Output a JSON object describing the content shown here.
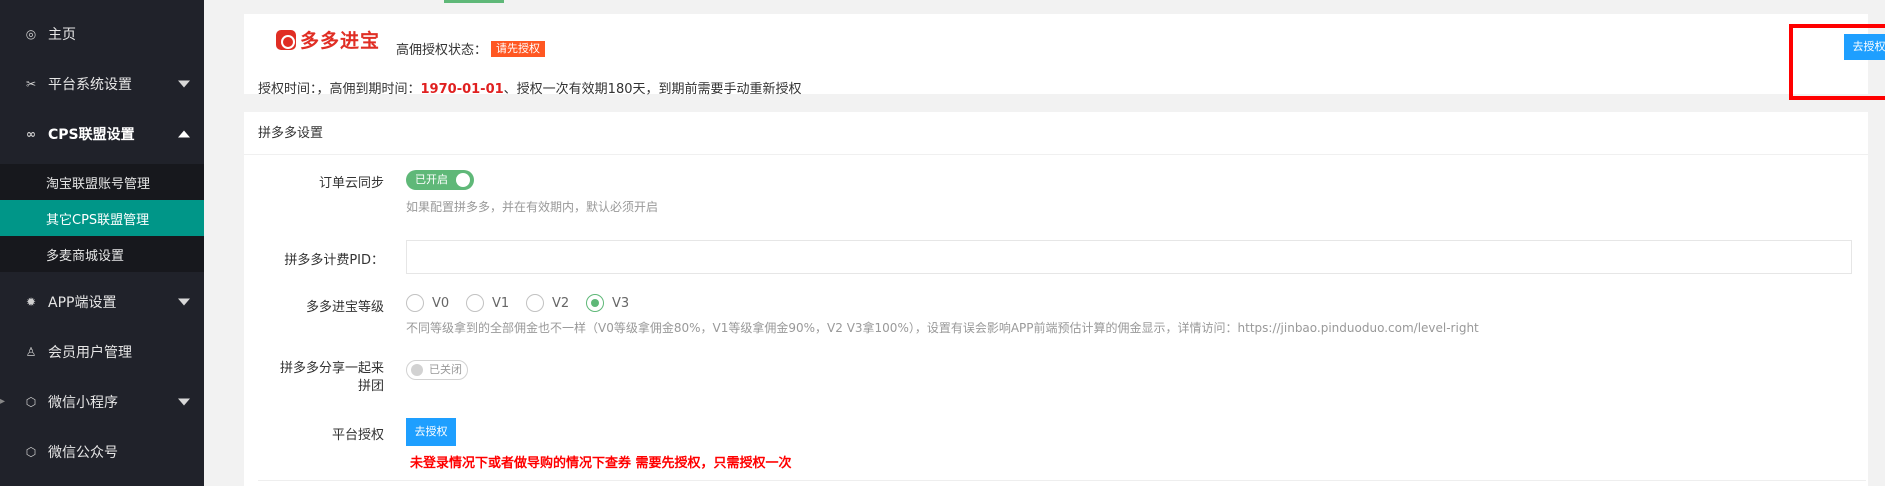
{
  "sidebar": {
    "items": [
      {
        "label": "主页",
        "icon": "shield-icon"
      },
      {
        "label": "平台系统设置",
        "icon": "tools-icon"
      },
      {
        "label": "CPS联盟设置",
        "icon": "infinity-icon"
      },
      {
        "label": "APP端设置",
        "icon": "gear-icon"
      },
      {
        "label": "会员用户管理",
        "icon": "user-icon"
      },
      {
        "label": "微信小程序",
        "icon": "cube-icon"
      },
      {
        "label": "微信公众号",
        "icon": "cube-icon"
      }
    ],
    "sub_items": [
      {
        "label": "淘宝联盟账号管理"
      },
      {
        "label": "其它CPS联盟管理"
      },
      {
        "label": "多麦商城设置"
      }
    ]
  },
  "auth_card": {
    "brand": "多多进宝",
    "status_label": "高佣授权状态：",
    "status_badge": "请先授权",
    "line_prefix": "授权时间：，高佣到期时间：",
    "expire_date": "1970-01-01",
    "line_suffix": "、授权一次有效期180天，到期前需要手动重新授权",
    "button": "去授权"
  },
  "pdd_card": {
    "title": "拼多多设置",
    "order_sync": {
      "label": "订单云同步",
      "switch": "已开启",
      "help": "如果配置拼多多，并在有效期内，默认必须开启"
    },
    "pid": {
      "label": "拼多多计费PID：",
      "value": "",
      "placeholder": ""
    },
    "level": {
      "label": "多多进宝等级",
      "options": [
        "V0",
        "V1",
        "V2",
        "V3"
      ],
      "selected": "V3",
      "help": "不同等级拿到的全部佣金也不一样（V0等级拿佣金80%，V1等级拿佣金90%，V2 V3拿100%），设置有误会影响APP前端预估计算的佣金显示，详情访问：https://jinbao.pinduoduo.com/level-right"
    },
    "share": {
      "label_line1": "拼多多分享一起来",
      "label_line2": "拼团",
      "switch": "已关闭"
    },
    "platform_auth": {
      "label": "平台授权",
      "button": "去授权",
      "warning": "未登录情况下或者做导购的情况下查券 需要先授权，只需授权一次"
    }
  },
  "colors": {
    "sidebar_bg": "#20222a",
    "active": "#009688",
    "button_blue": "#1e9fff",
    "switch_on": "#5fb878",
    "badge": "#ff5722",
    "highlight_box": "#ff0000"
  }
}
